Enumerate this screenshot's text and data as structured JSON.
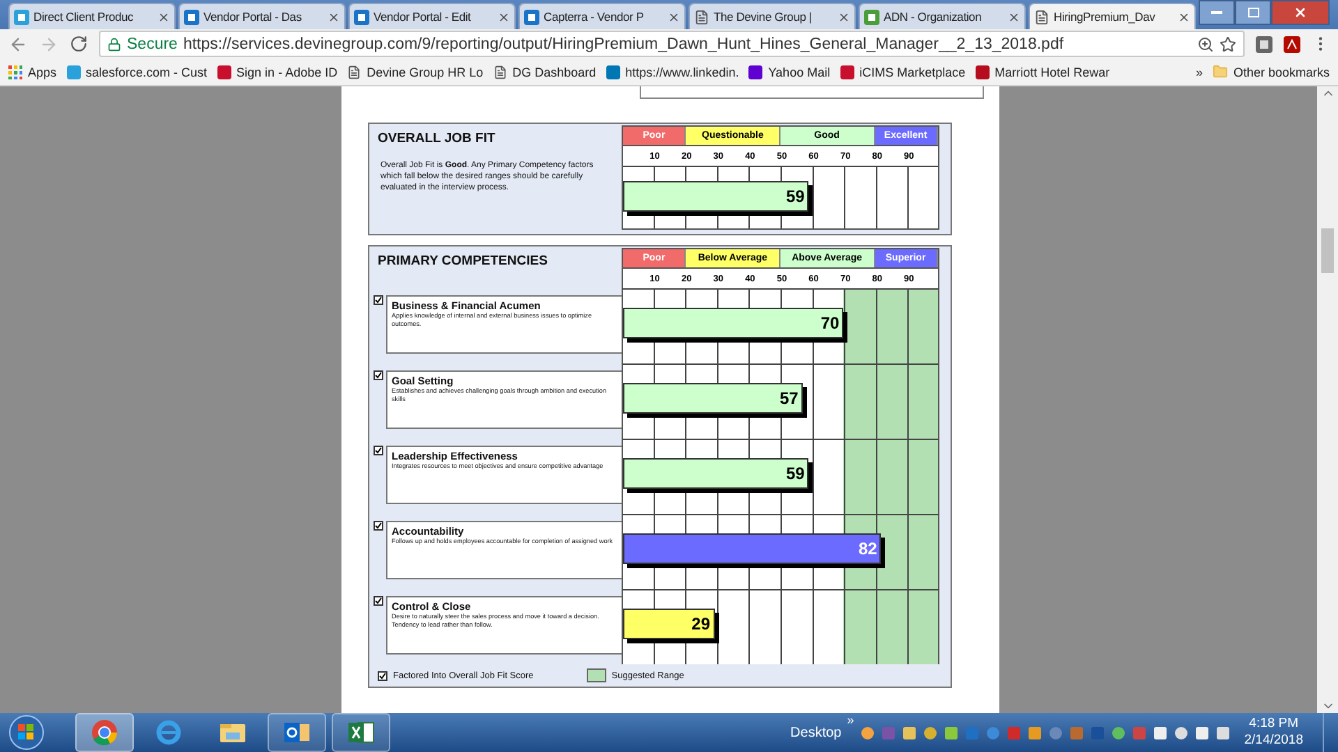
{
  "browser": {
    "tabs": [
      {
        "title": "Direct Client Produc",
        "selected": false
      },
      {
        "title": "Vendor Portal - Das",
        "selected": false
      },
      {
        "title": "Vendor Portal - Edit",
        "selected": false
      },
      {
        "title": "Capterra - Vendor P",
        "selected": false
      },
      {
        "title": "The Devine Group |",
        "selected": false
      },
      {
        "title": "ADN - Organization",
        "selected": false
      },
      {
        "title": "HiringPremium_Dav",
        "selected": true
      }
    ],
    "address": {
      "secure_label": "Secure",
      "url": "https://services.devinegroup.com/9/reporting/output/HiringPremium_Dawn_Hunt_Hines_General_Manager__2_13_2018.pdf"
    },
    "bookmarks": [
      "Apps",
      "salesforce.com - Cust",
      "Sign in - Adobe ID",
      "Devine Group HR Lo",
      "DG Dashboard",
      "https://www.linkedin.",
      "Yahoo Mail",
      "iCIMS Marketplace",
      "Marriott Hotel Rewar"
    ],
    "bookmarks_overflow": "»",
    "other_bookmarks": "Other bookmarks"
  },
  "report": {
    "overall": {
      "title": "OVERALL JOB FIT",
      "description": "Overall Job Fit is **Good**. Any Primary Competency factors which fall below the desired ranges should be carefully evaluated in the interview process.",
      "bands": [
        {
          "label": "Poor",
          "color": "#f26b6b"
        },
        {
          "label": "Questionable",
          "color": "#ffff66"
        },
        {
          "label": "Good",
          "color": "#ccffcc"
        },
        {
          "label": "Excellent",
          "color": "#6b6bff"
        }
      ],
      "ticks": [
        "10",
        "20",
        "30",
        "40",
        "50",
        "60",
        "70",
        "80",
        "90"
      ],
      "score": {
        "value": "59",
        "level": 0.59,
        "color": "#ccffcc"
      }
    },
    "competencies": {
      "title": "PRIMARY COMPETENCIES",
      "bands": [
        {
          "label": "Poor",
          "color": "#f26b6b"
        },
        {
          "label": "Below Average",
          "color": "#ffff66"
        },
        {
          "label": "Above Average",
          "color": "#ccffcc"
        },
        {
          "label": "Superior",
          "color": "#6b6bff"
        }
      ],
      "ticks": [
        "10",
        "20",
        "30",
        "40",
        "50",
        "60",
        "70",
        "80",
        "90"
      ],
      "items": [
        {
          "name": "Business & Financial Acumen",
          "description": "Applies knowledge of internal and external business issues to optimize outcomes.",
          "checked": true,
          "value": "70",
          "level": 0.7,
          "color": "#ccffcc"
        },
        {
          "name": "Goal Setting",
          "description": "Establishes and achieves challenging goals through ambition and execution skills",
          "checked": true,
          "value": "57",
          "level": 0.57,
          "color": "#ccffcc"
        },
        {
          "name": "Leadership Effectiveness",
          "description": "Integrates resources to meet objectives and ensure competitive advantage",
          "checked": true,
          "value": "59",
          "level": 0.59,
          "color": "#ccffcc"
        },
        {
          "name": "Accountability",
          "description": "Follows up and holds employees accountable for completion of assigned work",
          "checked": true,
          "value": "82",
          "level": 0.82,
          "color": "#6b6bff"
        },
        {
          "name": "Control & Close",
          "description": "Desire to naturally steer the sales process and move it toward a decision. Tendency to lead rather than follow.",
          "checked": true,
          "value": "29",
          "level": 0.29,
          "color": "#ffff66"
        }
      ],
      "legend": {
        "factored": {
          "label": "Factored Into Overall Job Fit Score",
          "checked": true
        },
        "suggested": {
          "label": "Suggested Range"
        }
      }
    }
  },
  "taskbar": {
    "apps": [
      {
        "running": true,
        "selected": true
      },
      {
        "running": false,
        "selected": false
      },
      {
        "running": false,
        "selected": false
      },
      {
        "running": true,
        "selected": false
      },
      {
        "running": true,
        "selected": false
      }
    ],
    "desktop_label": "Desktop",
    "overflow": "»",
    "time": "4:18 PM",
    "date": "2/14/2018"
  }
}
